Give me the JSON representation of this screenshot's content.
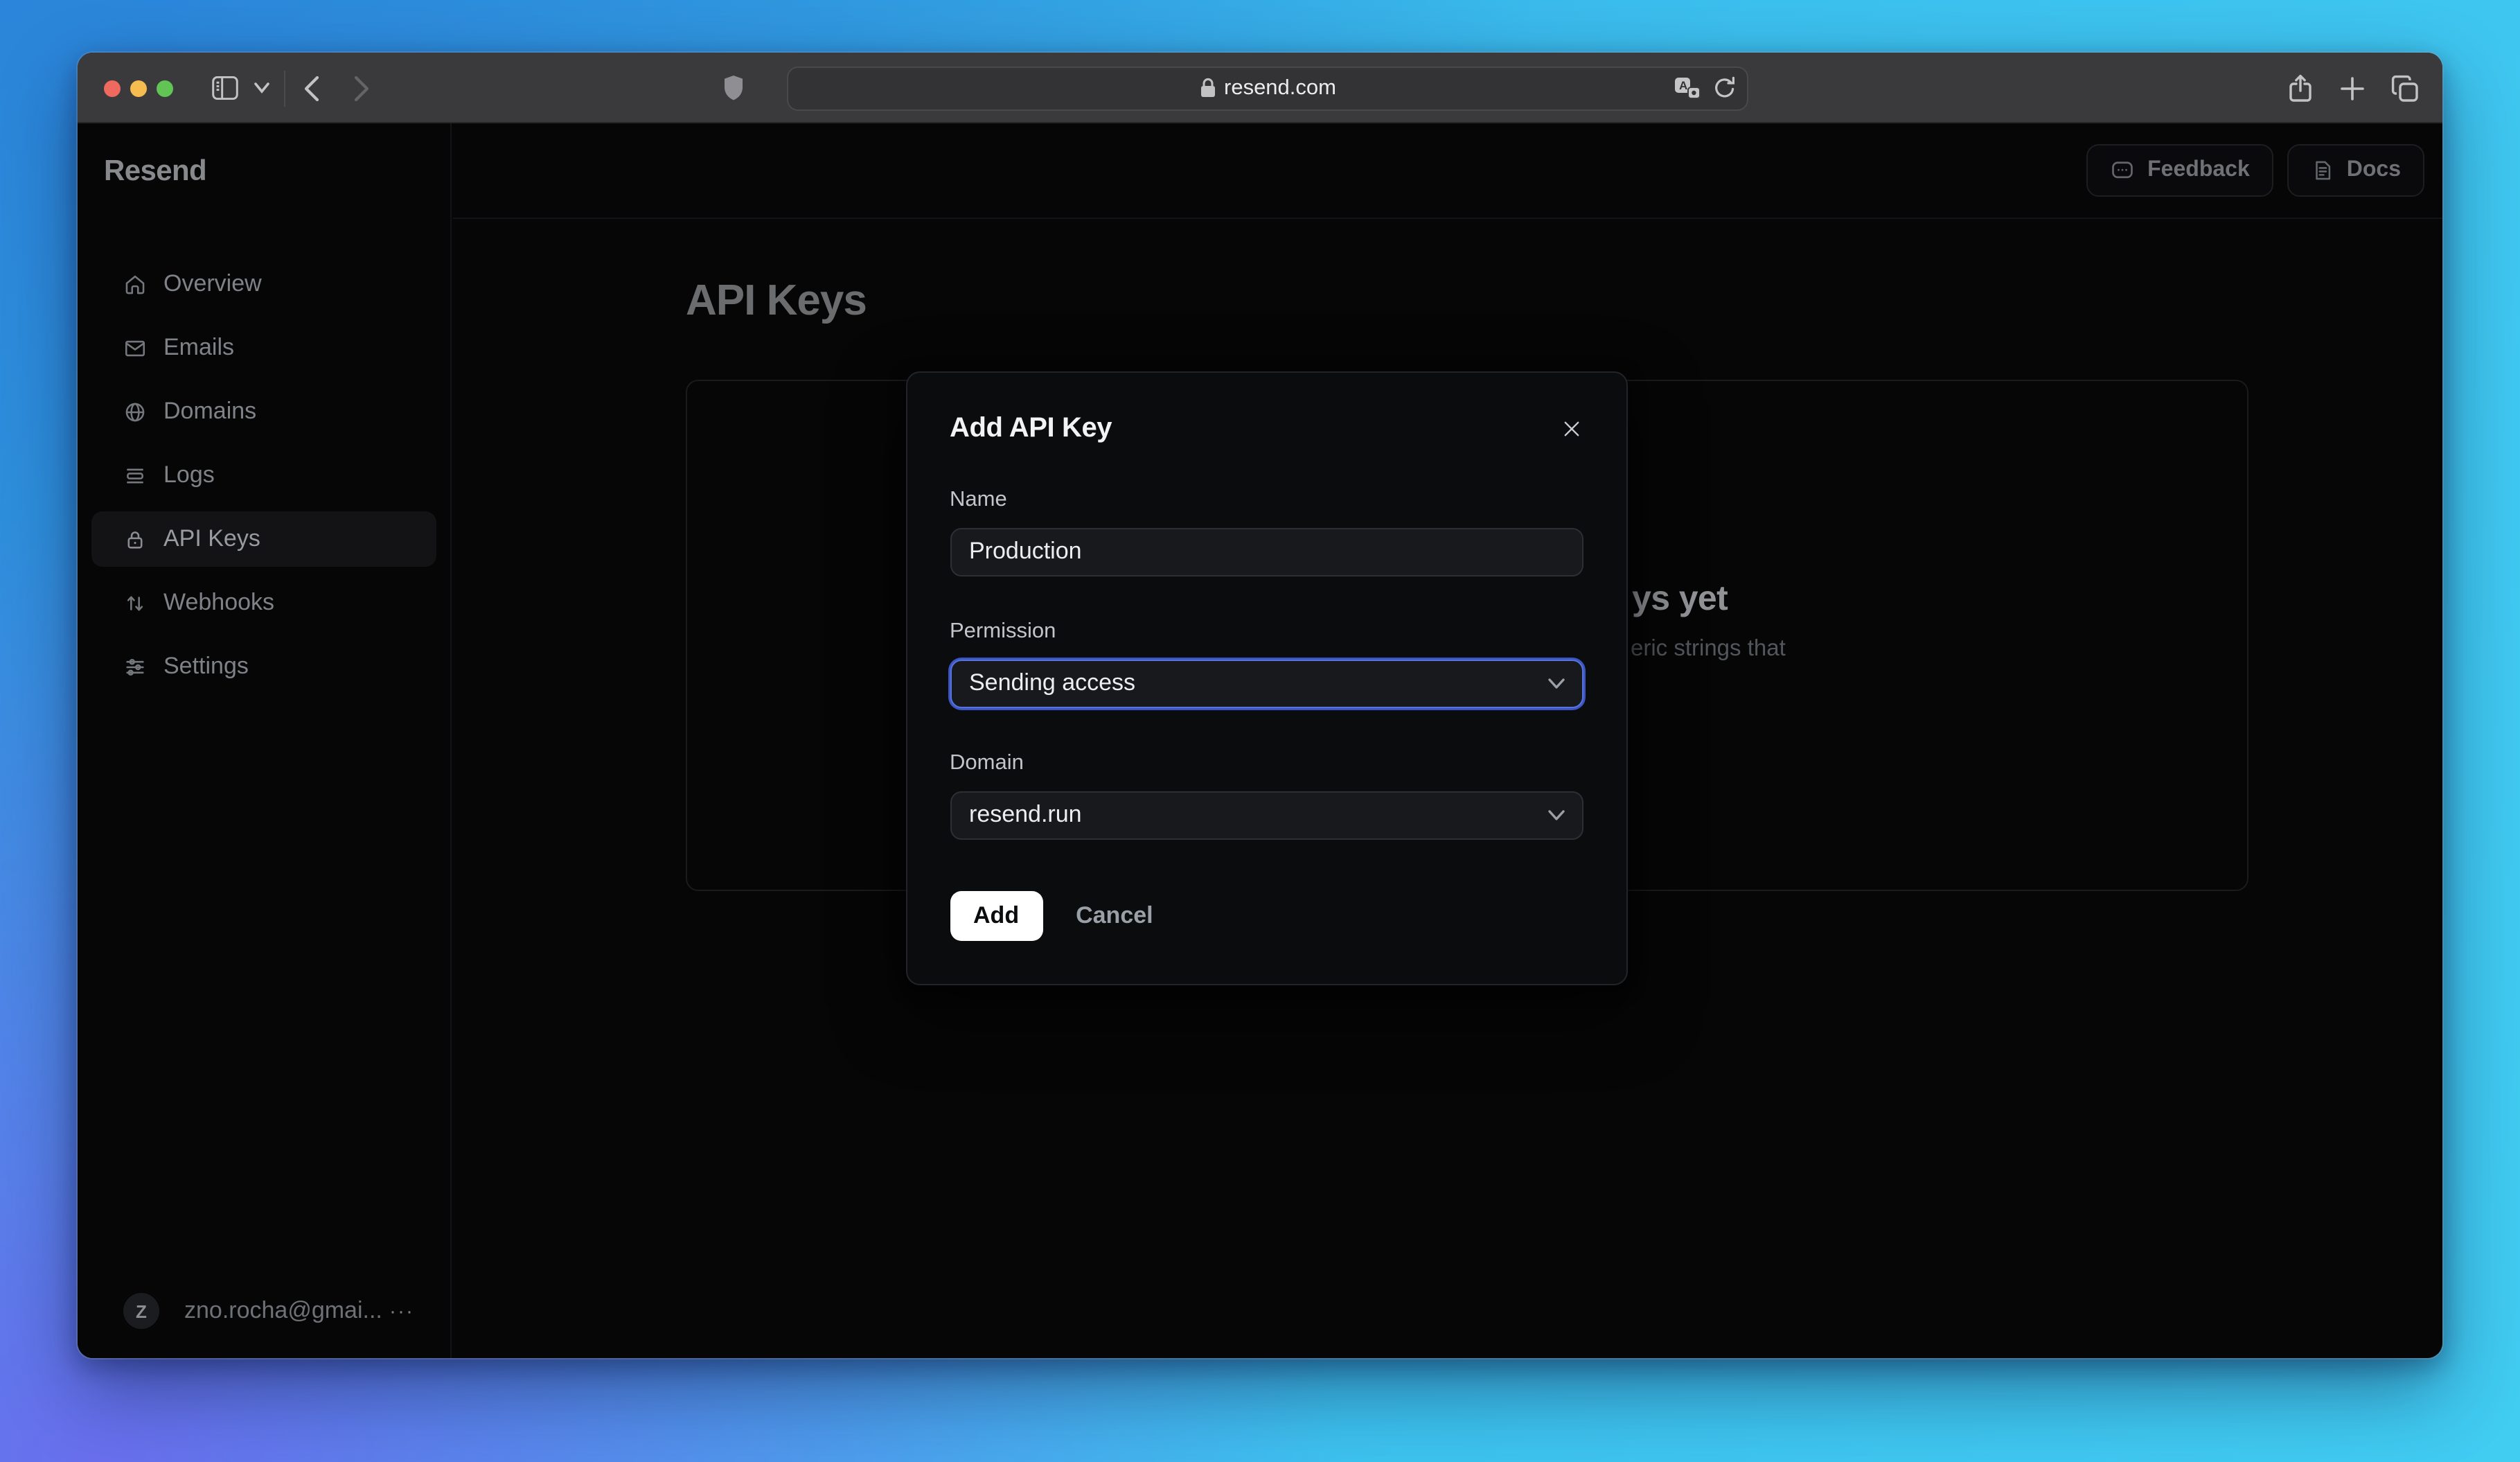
{
  "browser": {
    "url": "resend.com",
    "icons": [
      "traffic-close",
      "traffic-minimize",
      "traffic-zoom",
      "sidebar-toggle",
      "chevron-down",
      "back",
      "forward",
      "shield",
      "lock",
      "translate",
      "reload",
      "share",
      "new-tab-plus",
      "tab-overview"
    ]
  },
  "sidebar": {
    "logo": "Resend",
    "items": [
      {
        "label": "Overview",
        "icon": "home-icon",
        "active": false
      },
      {
        "label": "Emails",
        "icon": "mail-icon",
        "active": false
      },
      {
        "label": "Domains",
        "icon": "globe-icon",
        "active": false
      },
      {
        "label": "Logs",
        "icon": "logs-icon",
        "active": false
      },
      {
        "label": "API Keys",
        "icon": "lock-icon",
        "active": true
      },
      {
        "label": "Webhooks",
        "icon": "arrows-up-down-icon",
        "active": false
      },
      {
        "label": "Settings",
        "icon": "sliders-icon",
        "active": false
      }
    ],
    "user": {
      "initial": "Z",
      "email": "zno.rocha@gmai...",
      "menu": "···"
    }
  },
  "header": {
    "feedback_label": "Feedback",
    "docs_label": "Docs"
  },
  "main": {
    "title": "API Keys",
    "empty_state": {
      "title_fragment": "ys yet",
      "description_fragment": "eric strings that"
    }
  },
  "modal": {
    "title": "Add API Key",
    "fields": {
      "name": {
        "label": "Name",
        "value": "Production"
      },
      "permission": {
        "label": "Permission",
        "value": "Sending access",
        "focused": true
      },
      "domain": {
        "label": "Domain",
        "value": "resend.run"
      }
    },
    "actions": {
      "add": "Add",
      "cancel": "Cancel"
    }
  },
  "colors": {
    "traffic_close": "#ee6a5f",
    "traffic_minimize": "#f5bd4f",
    "traffic_zoom": "#61c454",
    "focus_ring": "#5474e0",
    "modal_bg": "#0b0c0e",
    "add_button_bg": "#ffffff",
    "gradient_top_left": "#2b85da",
    "gradient_bottom_left": "#6c6cee",
    "gradient_right": "#3ec6ef"
  }
}
